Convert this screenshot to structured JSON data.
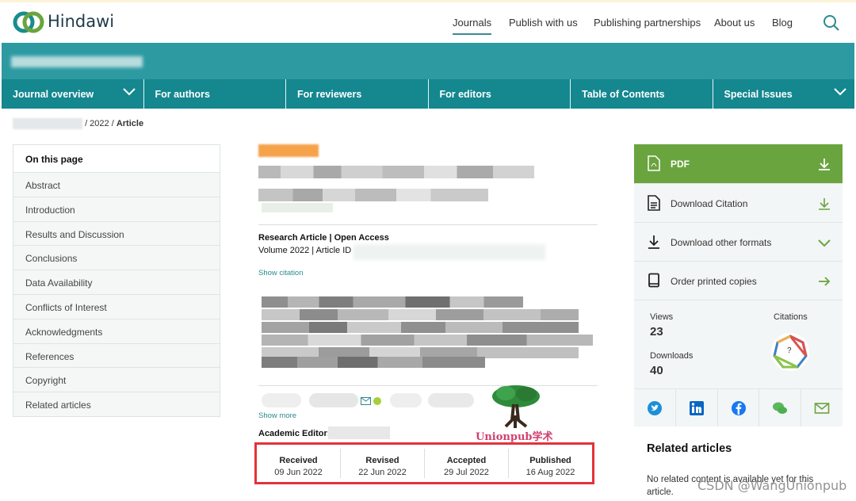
{
  "header": {
    "brand": "Hindawi",
    "nav": [
      "Journals",
      "Publish with us",
      "Publishing partnerships",
      "About us",
      "Blog"
    ],
    "active_nav": "Journals"
  },
  "journal_nav": [
    "Journal overview",
    "For authors",
    "For reviewers",
    "For editors",
    "Table of Contents",
    "Special Issues"
  ],
  "breadcrumb": {
    "year": "/ 2022 /",
    "current": "Article"
  },
  "toc": {
    "title": "On this page",
    "items": [
      "Abstract",
      "Introduction",
      "Results and Discussion",
      "Conclusions",
      "Data Availability",
      "Conflicts of Interest",
      "Acknowledgments",
      "References",
      "Copyright",
      "Related articles"
    ]
  },
  "article": {
    "type_line": "Research Article | Open Access",
    "volume_line": "Volume 2022 | Article ID",
    "show_citation": "Show citation",
    "show_more": "Show more",
    "academic_editor": "Academic Editor:",
    "dates": [
      {
        "label": "Received",
        "value": "09 Jun 2022"
      },
      {
        "label": "Revised",
        "value": "22 Jun 2022"
      },
      {
        "label": "Accepted",
        "value": "29 Jul 2022"
      },
      {
        "label": "Published",
        "value": "16 Aug 2022"
      }
    ]
  },
  "sidebar": {
    "pdf": "PDF",
    "actions": [
      "Download Citation",
      "Download other formats",
      "Order printed copies"
    ],
    "views_label": "Views",
    "views": "23",
    "downloads_label": "Downloads",
    "downloads": "40",
    "citations_label": "Citations",
    "citations_value": "?",
    "related_title": "Related articles",
    "related_text": "No related content is available yet for this article."
  },
  "overlay": {
    "stamp": "Unionpub学术",
    "watermark": "CSDN @WangUnionpub"
  },
  "colors": {
    "teal": "#14878f",
    "banner": "#2d9aa2",
    "green": "#6aa43e",
    "highlight": "#e3323a"
  }
}
